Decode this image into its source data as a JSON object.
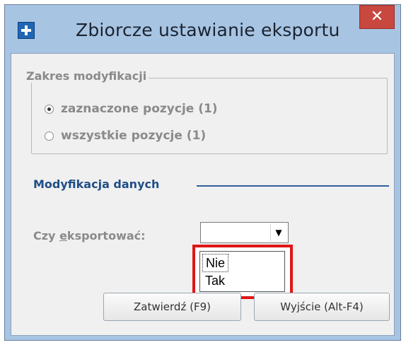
{
  "window": {
    "title": "Zbiorcze ustawianie eksportu",
    "close_label": "✕"
  },
  "range_group": {
    "legend": "Zakres modyfikacji",
    "options": [
      {
        "label": "zaznaczone pozycje (1)",
        "checked": true
      },
      {
        "label": "wszystkie pozycje (1)",
        "checked": false
      }
    ]
  },
  "data_section": {
    "title": "Modyfikacja danych",
    "export_label_prefix": "Czy ",
    "export_label_accel": "e",
    "export_label_suffix": "ksportować:",
    "combo_value": "",
    "combo_arrow": "▼",
    "options": [
      "Nie",
      "Tak"
    ]
  },
  "buttons": {
    "confirm": "Zatwierdź (F9)",
    "exit": "Wyjście (Alt-F4)"
  },
  "colors": {
    "title_bar": "#a8c4e3",
    "close_button": "#c8483f",
    "section_title": "#1f4e86",
    "highlight_box": "#e01515"
  }
}
